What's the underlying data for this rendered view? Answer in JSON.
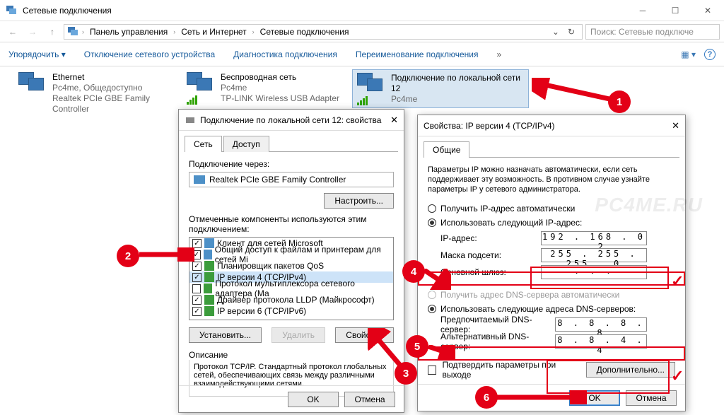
{
  "window": {
    "title": "Сетевые подключения"
  },
  "breadcrumb": {
    "a": "Панель управления",
    "b": "Сеть и Интернет",
    "c": "Сетевые подключения"
  },
  "search": {
    "placeholder": "Поиск: Сетевые подключе"
  },
  "cmd": {
    "organize": "Упорядочить",
    "disable": "Отключение сетевого устройства",
    "diag": "Диагностика подключения",
    "rename": "Переименование подключения"
  },
  "conn1": {
    "name": "Ethernet",
    "line2": "Pc4me, Общедоступно",
    "line3": "Realtek PCIe GBE Family Controller"
  },
  "conn2": {
    "name": "Беспроводная сеть",
    "line2": "Pc4me",
    "line3": "TP-LINK Wireless USB Adapter"
  },
  "conn3": {
    "name": "Подключение по локальной сети 12",
    "line2": "Pc4me"
  },
  "props": {
    "title": "Подключение по локальной сети 12: свойства",
    "tab_net": "Сеть",
    "tab_access": "Доступ",
    "connect_via": "Подключение через:",
    "adapter": "Realtek PCIe GBE Family Controller",
    "configure": "Настроить...",
    "components": "Отмеченные компоненты используются этим подключением:",
    "items": [
      "Клиент для сетей Microsoft",
      "Общий доступ к файлам и принтерам для сетей Mi",
      "Планировщик пакетов QoS",
      "IP версии 4 (TCP/IPv4)",
      "Протокол мультиплексора сетевого адаптера (Ма",
      "Драйвер протокола LLDP (Майкрософт)",
      "IP версии 6 (TCP/IPv6)"
    ],
    "install": "Установить...",
    "remove": "Удалить",
    "btn_props": "Свойства",
    "desc_h": "Описание",
    "desc": "Протокол TCP/IP. Стандартный протокол глобальных сетей, обеспечивающих связь между различными взаимодействующими сетями.",
    "ok": "OK",
    "cancel": "Отмена"
  },
  "ipv4": {
    "title": "Свойства: IP версии 4 (TCP/IPv4)",
    "tab": "Общие",
    "info": "Параметры IP можно назначать автоматически, если сеть поддерживает эту возможность. В противном случае узнайте параметры IP у сетевого администратора.",
    "r_auto": "Получить IP-адрес автоматически",
    "r_manual": "Использовать следующий IP-адрес:",
    "lbl_ip": "IP-адрес:",
    "val_ip": "192 . 168 .  0  .  2",
    "lbl_mask": "Маска подсети:",
    "val_mask": "255 . 255 . 255 .  0",
    "lbl_gw": "Основной шлюз:",
    "val_gw": " .       .       . ",
    "r_dns_auto": "Получить адрес DNS-сервера автоматически",
    "r_dns_manual": "Использовать следующие адреса DNS-серверов:",
    "lbl_dns1": "Предпочитаемый DNS-сервер:",
    "val_dns1": "8  .  8  .  8  .  8",
    "lbl_dns2": "Альтернативный DNS-сервер:",
    "val_dns2": "8  .  8  .  4  .  4",
    "validate": "Подтвердить параметры при выходе",
    "advanced": "Дополнительно...",
    "ok": "OK",
    "cancel": "Отмена"
  },
  "watermark": "PC4ME.RU",
  "steps": {
    "1": "1",
    "2": "2",
    "3": "3",
    "4": "4",
    "5": "5",
    "6": "6"
  }
}
